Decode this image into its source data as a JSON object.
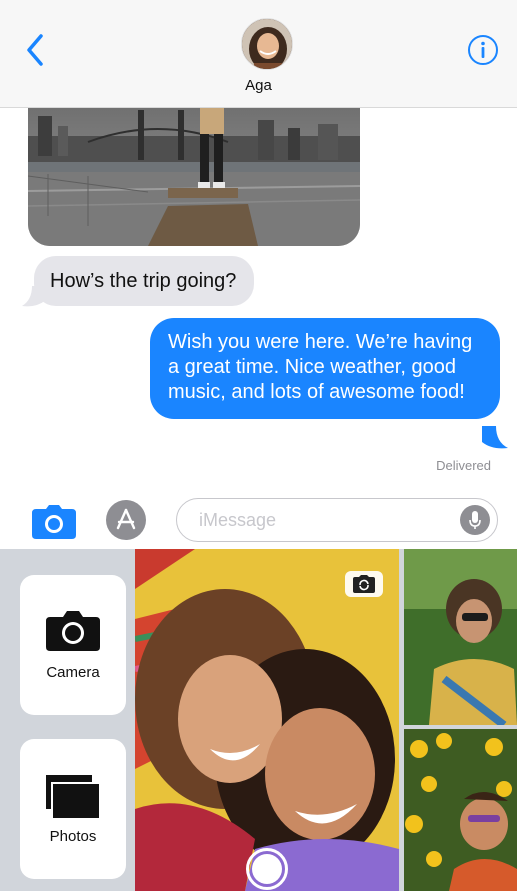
{
  "header": {
    "contact_name": "Aga"
  },
  "conversation": {
    "incoming_text": "How’s the trip going?",
    "outgoing_text": "Wish you were here. We’re having a great time. Nice weather, good music, and lots of awesome food!",
    "status": "Delivered"
  },
  "input_bar": {
    "placeholder": "iMessage",
    "value": ""
  },
  "tray": {
    "camera_label": "Camera",
    "photos_label": "Photos"
  },
  "icons": {
    "back": "chevron-left-icon",
    "info": "info-icon",
    "camera": "camera-icon",
    "app_store": "app-store-icon",
    "microphone": "microphone-icon",
    "photos": "photos-stack-icon",
    "flip": "flip-camera-icon"
  },
  "colors": {
    "accent": "#1a85ff",
    "incoming_bubble": "#e5e5ea",
    "status_text": "#8e8e93"
  }
}
